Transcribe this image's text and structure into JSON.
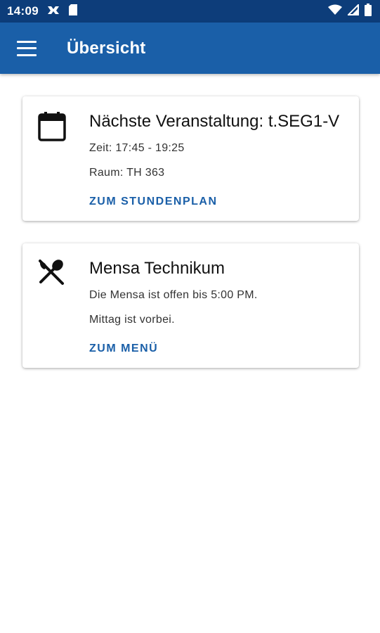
{
  "status_bar": {
    "time": "14:09"
  },
  "app_bar": {
    "title": "Übersicht"
  },
  "cards": [
    {
      "icon": "calendar-icon",
      "title": "Nächste Veranstaltung: t.SEG1-V",
      "lines": [
        "Zeit: 17:45 - 19:25",
        "Raum: TH 363"
      ],
      "action": "ZUM STUNDENPLAN"
    },
    {
      "icon": "cutlery-icon",
      "title": "Mensa Technikum",
      "lines": [
        "Die Mensa ist offen bis 5:00 PM.",
        "Mittag ist vorbei."
      ],
      "action": "ZUM MENÜ"
    }
  ],
  "colors": {
    "status_bar": "#0d3d7a",
    "app_bar": "#1a5fa8",
    "accent": "#1a5fa8"
  }
}
